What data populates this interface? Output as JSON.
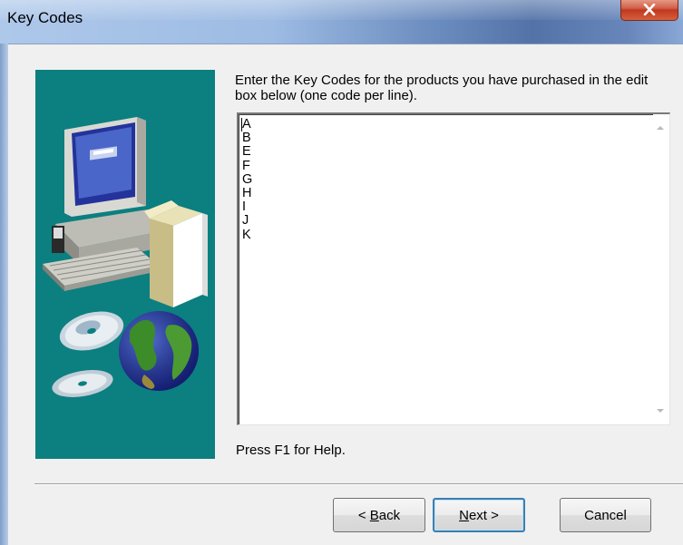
{
  "window": {
    "title": "Key Codes",
    "close_glyph": "✕"
  },
  "panel": {
    "background_color": "#0c7f80",
    "illustration_icons": [
      "computer-icon",
      "software-box-icon",
      "cd-discs-icon",
      "globe-icon"
    ]
  },
  "main": {
    "instructions": "Enter the Key Codes for the products you have purchased in the edit box below (one code per line).",
    "codes": [
      "A",
      "B",
      "E",
      "F",
      "G",
      "H",
      "I",
      "J",
      "K"
    ],
    "help_text": "Press F1 for Help."
  },
  "buttons": {
    "back": {
      "mnemonic_prefix": "< ",
      "mnemonic": "B",
      "rest": "ack"
    },
    "next": {
      "mnemonic": "N",
      "rest": "ext >"
    },
    "cancel": "Cancel"
  }
}
